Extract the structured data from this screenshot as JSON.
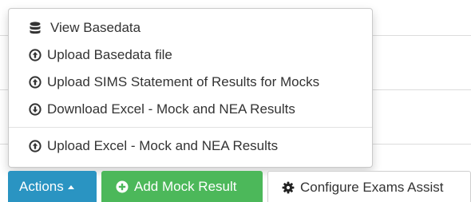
{
  "menu": {
    "items": [
      {
        "label": "View Basedata",
        "icon": "database-icon"
      },
      {
        "label": "Upload Basedata file",
        "icon": "arrow-circle-up-icon"
      },
      {
        "label": "Upload SIMS Statement of Results for Mocks",
        "icon": "arrow-circle-up-icon"
      },
      {
        "label": "Download Excel - Mock and NEA Results",
        "icon": "arrow-circle-down-icon"
      },
      {
        "label": "Upload Excel - Mock and NEA Results",
        "icon": "arrow-circle-up-icon"
      }
    ]
  },
  "toolbar": {
    "actions_label": "Actions",
    "add_mock_label": "Add Mock Result",
    "configure_label": "Configure Exams Assist"
  },
  "colors": {
    "actions_bg": "#2a94c2",
    "add_bg": "#4cb85a",
    "text": "#333333"
  }
}
